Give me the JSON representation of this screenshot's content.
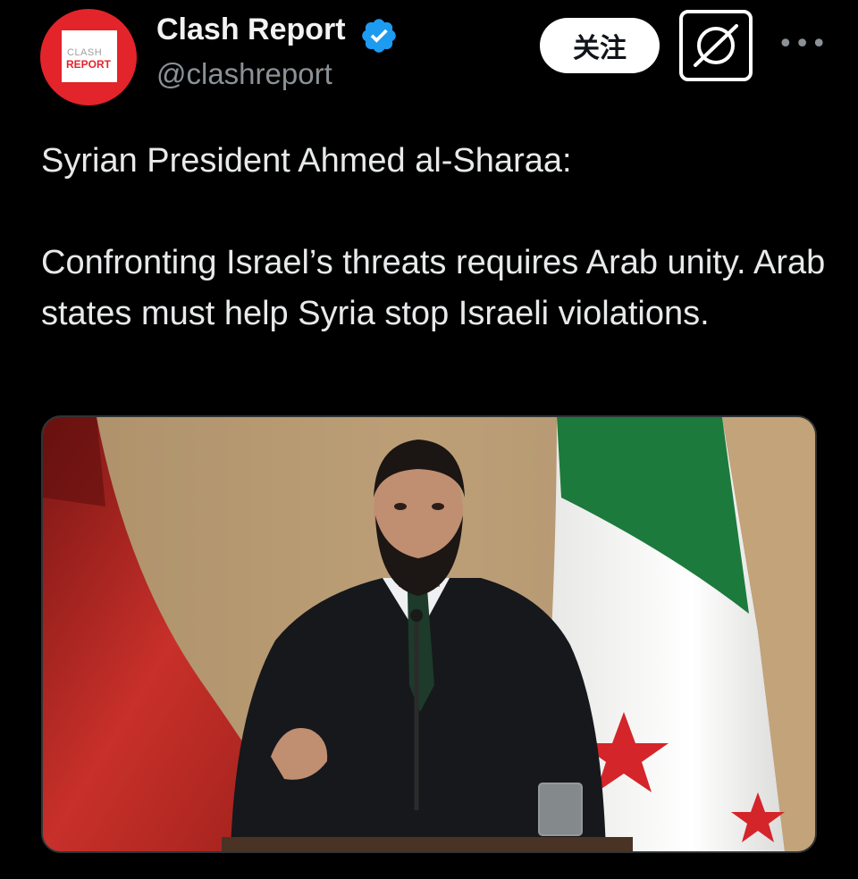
{
  "author": {
    "display_name": "Clash Report",
    "handle": "@clashreport",
    "avatar_text_top": "CLASH",
    "avatar_text_bottom": "REPORT",
    "verified_icon": "verified-badge-icon"
  },
  "actions": {
    "follow_label": "关注",
    "grok_icon": "grok-icon",
    "more_icon": "more-options-icon"
  },
  "tweet": {
    "text": "Syrian President Ahmed al-Sharaa:\n\nConfronting Israel’s threats requires Arab unity. Arab states must help Syria stop Israeli violations."
  },
  "colors": {
    "background": "#000000",
    "verified_blue": "#1d9bf0",
    "avatar_red": "#e3242b",
    "handle_gray": "#8b9196"
  }
}
